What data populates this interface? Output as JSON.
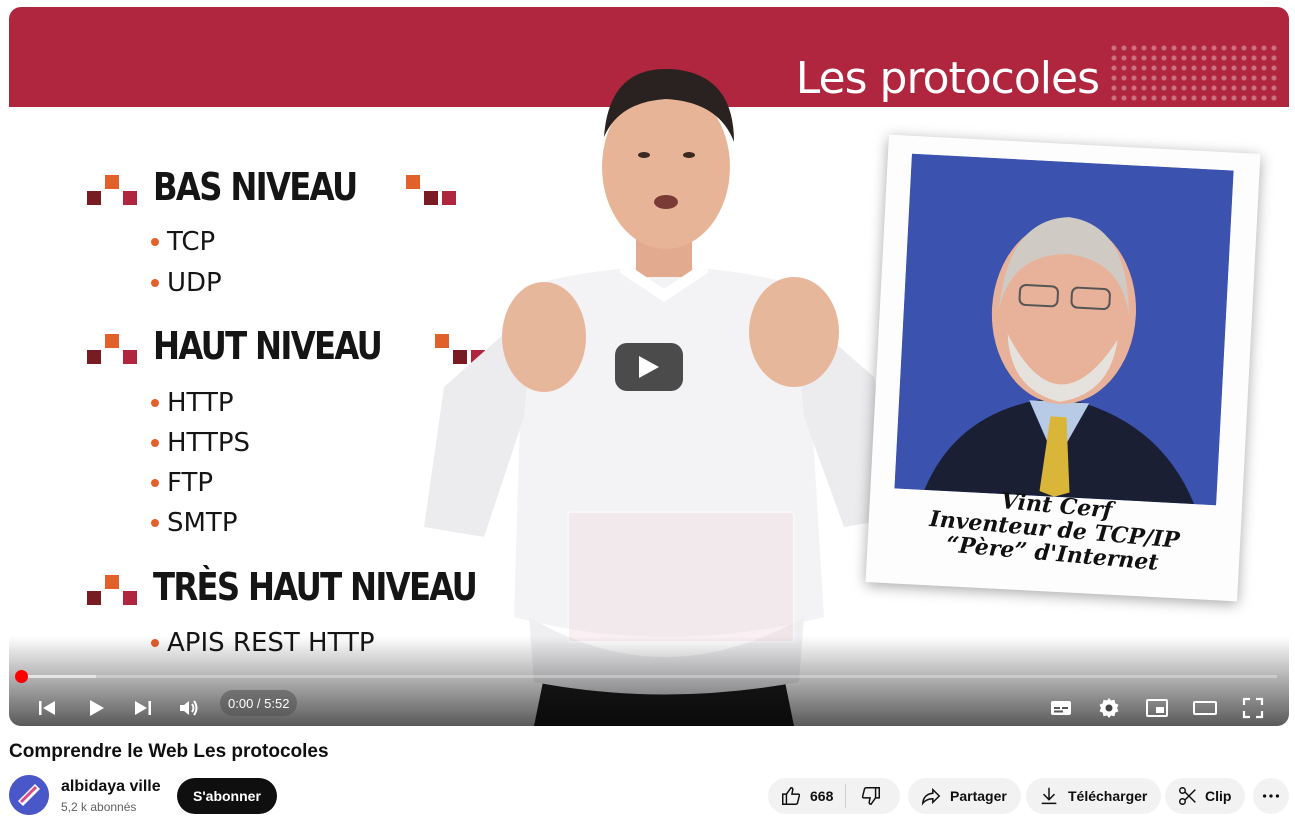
{
  "slide": {
    "title": "Les protocoles",
    "sections": [
      {
        "heading": "BAS NIVEAU",
        "items": [
          "TCP",
          "UDP"
        ]
      },
      {
        "heading": "HAUT NIVEAU",
        "items": [
          "HTTP",
          "HTTPS",
          "FTP",
          "SMTP"
        ]
      },
      {
        "heading": "TRÈS HAUT NIVEAU",
        "items": [
          "APIS REST HTTP"
        ]
      }
    ],
    "polaroid_caption": [
      "Vint Cerf",
      "Inventeur de TCP/IP",
      "“Père” d'Internet"
    ]
  },
  "player": {
    "time_display": "0:00 / 5:52",
    "progress_fraction": 0.0,
    "loaded_fraction": 0.06,
    "icons": {
      "prev": "skip-previous-icon",
      "play": "play-icon",
      "next": "skip-next-icon",
      "volume": "volume-icon",
      "subtitles": "subtitles-icon",
      "settings": "gear-icon",
      "miniplayer": "miniplayer-icon",
      "theater": "theater-mode-icon",
      "fullscreen": "fullscreen-icon"
    },
    "accent_color": "#ff0000"
  },
  "video": {
    "title": "Comprendre le Web Les protocoles",
    "channel": "albidaya ville",
    "subscribers": "5,2 k abonnés",
    "subscribe_label": "S'abonner",
    "likes": "668",
    "share_label": "Partager",
    "download_label": "Télécharger",
    "clip_label": "Clip"
  },
  "colors": {
    "slide_header": "#b0263e",
    "bullet": "#e2612b"
  }
}
